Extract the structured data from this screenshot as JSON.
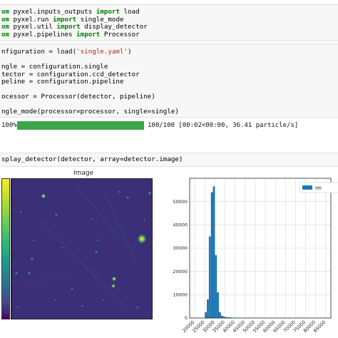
{
  "cell1": {
    "lines": [
      [
        [
          "om ",
          "kw"
        ],
        [
          "pyxel.inputs_outputs ",
          ""
        ],
        [
          "import",
          "kw"
        ],
        [
          " load",
          ""
        ]
      ],
      [
        [
          "om ",
          "kw"
        ],
        [
          "pyxel.run ",
          ""
        ],
        [
          "import",
          "kw"
        ],
        [
          " single_mode",
          ""
        ]
      ],
      [
        [
          "om ",
          "kw"
        ],
        [
          "pyxel.util ",
          ""
        ],
        [
          "import",
          "kw"
        ],
        [
          " display_detector",
          ""
        ]
      ],
      [
        [
          "om ",
          "kw"
        ],
        [
          "pyxel.pipelines ",
          ""
        ],
        [
          "import",
          "kw"
        ],
        [
          " Processor",
          ""
        ]
      ]
    ]
  },
  "cell2": {
    "lines": [
      [
        [
          "nfiguration = load(",
          ""
        ],
        [
          "'single.yaml'",
          "str"
        ],
        [
          ")",
          ""
        ]
      ],
      [
        [
          "",
          ""
        ]
      ],
      [
        [
          "ngle = configuration.single",
          ""
        ]
      ],
      [
        [
          "tector = configuration.ccd_detector",
          ""
        ]
      ],
      [
        [
          "peline = configuration.pipeline",
          ""
        ]
      ],
      [
        [
          "",
          ""
        ]
      ],
      [
        [
          "ocessor = Processor(detector, pipeline)",
          ""
        ]
      ],
      [
        [
          "",
          ""
        ]
      ],
      [
        [
          "ngle_mode(processor=processor, single=single)",
          ""
        ]
      ]
    ]
  },
  "progress": {
    "percent_label": "100%",
    "fraction": 1.0,
    "status": "100/100 [00:02<00:00, 36.41 particle/s]",
    "color": "#3ca64a"
  },
  "cell3": {
    "lines": [
      [
        [
          "splay_detector(detector, array=detector.image)",
          ""
        ]
      ]
    ]
  },
  "image_panel": {
    "title": "Image"
  },
  "histogram": {
    "legend_label": "Im",
    "color": "#1f77b4",
    "y_ticks": [
      "0",
      "10000",
      "20000",
      "30000",
      "40000",
      "50000"
    ],
    "x_ticks": [
      "20000",
      "25000",
      "30000",
      "35000",
      "40000",
      "45000",
      "50000",
      "55000",
      "60000",
      "65000",
      "70000",
      "75000",
      "80000",
      "85000"
    ],
    "chart_data": {
      "type": "bar",
      "xlim": [
        17500,
        87500
      ],
      "ylim": [
        0,
        60000
      ],
      "grid": true,
      "bins": [
        [
          25000,
          26000,
          2500
        ],
        [
          26000,
          27000,
          8000
        ],
        [
          27000,
          28000,
          35000
        ],
        [
          28000,
          29000,
          54000
        ],
        [
          29000,
          30000,
          56500
        ],
        [
          30000,
          31000,
          27000
        ],
        [
          31000,
          32000,
          11000
        ],
        [
          32000,
          33000,
          2500
        ],
        [
          33000,
          34000,
          1000
        ],
        [
          34000,
          35000,
          600
        ],
        [
          35000,
          36000,
          400
        ],
        [
          36000,
          37000,
          300
        ],
        [
          37000,
          38000,
          300
        ],
        [
          38000,
          39000,
          150
        ],
        [
          39000,
          40000,
          100
        ]
      ]
    }
  }
}
